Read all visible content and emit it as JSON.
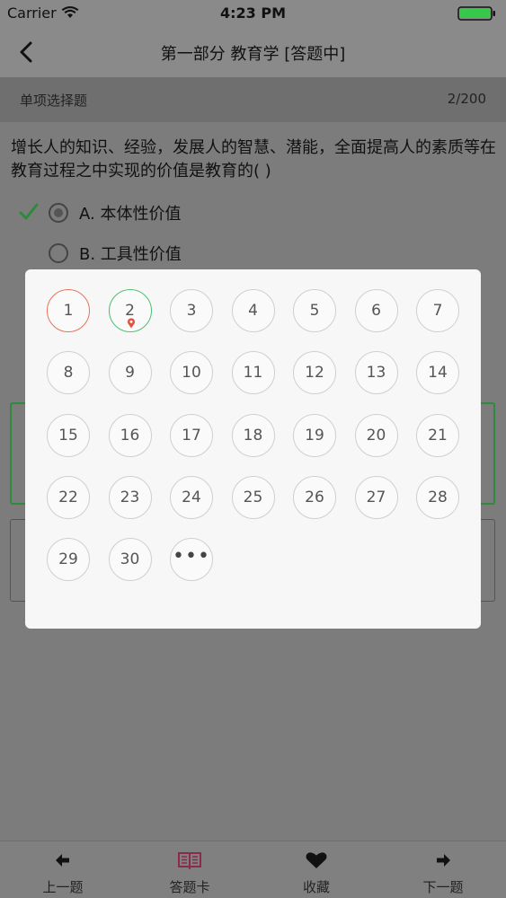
{
  "status_bar": {
    "carrier": "Carrier",
    "time": "4:23 PM"
  },
  "nav": {
    "title": "第一部分 教育学 [答题中]"
  },
  "subheader": {
    "question_type": "单项选择题",
    "progress": "2/200"
  },
  "question": {
    "text": "增长人的知识、经验，发展人的智慧、潜能，全面提高人的素质等在教育过程之中实现的价值是教育的(   )",
    "options": [
      {
        "label": "A. 本体性价值",
        "selected": true,
        "marked_correct": true
      },
      {
        "label": "B. 工具性价值",
        "selected": false
      }
    ]
  },
  "answer_card": {
    "numbers": [
      "1",
      "2",
      "3",
      "4",
      "5",
      "6",
      "7",
      "8",
      "9",
      "10",
      "11",
      "12",
      "13",
      "14",
      "15",
      "16",
      "17",
      "18",
      "19",
      "20",
      "21",
      "22",
      "23",
      "24",
      "25",
      "26",
      "27",
      "28",
      "29",
      "30"
    ],
    "current": "1",
    "answered": "2",
    "more_label": "•••"
  },
  "colors": {
    "current_ring": "#e5735a",
    "answered_ring": "#4fbf72",
    "pin": "#e0533f",
    "check": "#2e8a3a",
    "tab_active": "#8b2a4a"
  },
  "tabs": [
    {
      "label": "上一题",
      "icon": "arrow-left-icon"
    },
    {
      "label": "答题卡",
      "icon": "answer-card-icon"
    },
    {
      "label": "收藏",
      "icon": "heart-icon"
    },
    {
      "label": "下一题",
      "icon": "arrow-right-icon"
    }
  ]
}
